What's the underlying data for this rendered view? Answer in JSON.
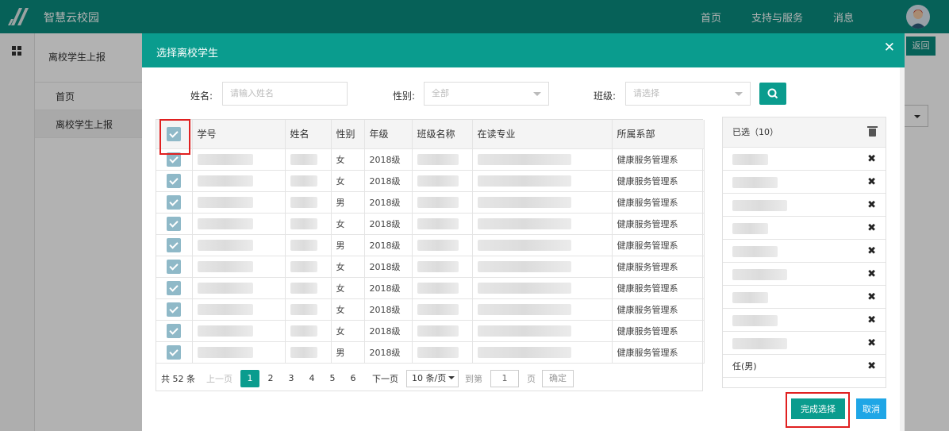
{
  "app": {
    "title": "智慧云校园"
  },
  "top_nav": [
    "首页",
    "支持与服务",
    "消息"
  ],
  "sidebar": {
    "title": "离校学生上报",
    "items": [
      {
        "label": "首页",
        "active": false
      },
      {
        "label": "离校学生上报",
        "active": true
      }
    ]
  },
  "background": {
    "back_button": "返回"
  },
  "modal": {
    "title": "选择离校学生",
    "close_icon": "close-icon",
    "filters": {
      "name_label": "姓名:",
      "name_placeholder": "请输入姓名",
      "gender_label": "性别:",
      "gender_value": "全部",
      "class_label": "班级:",
      "class_placeholder": "请选择",
      "search_icon": "search-icon"
    },
    "table": {
      "columns": [
        "学号",
        "姓名",
        "性别",
        "年级",
        "班级名称",
        "在读专业",
        "所属系部"
      ],
      "rows": [
        {
          "gender": "女",
          "grade": "2018级",
          "dept": "健康服务管理系"
        },
        {
          "gender": "女",
          "grade": "2018级",
          "dept": "健康服务管理系"
        },
        {
          "gender": "男",
          "grade": "2018级",
          "dept": "健康服务管理系"
        },
        {
          "gender": "女",
          "grade": "2018级",
          "dept": "健康服务管理系"
        },
        {
          "gender": "男",
          "grade": "2018级",
          "dept": "健康服务管理系"
        },
        {
          "gender": "女",
          "grade": "2018级",
          "dept": "健康服务管理系"
        },
        {
          "gender": "女",
          "grade": "2018级",
          "dept": "健康服务管理系"
        },
        {
          "gender": "女",
          "grade": "2018级",
          "dept": "健康服务管理系"
        },
        {
          "gender": "女",
          "grade": "2018级",
          "dept": "健康服务管理系"
        },
        {
          "gender": "男",
          "grade": "2018级",
          "dept": "健康服务管理系"
        }
      ]
    },
    "pagination": {
      "total": "共 52 条",
      "prev": "上一页",
      "pages": [
        "1",
        "2",
        "3",
        "4",
        "5",
        "6"
      ],
      "current": "1",
      "next": "下一页",
      "page_size": "10 条/页",
      "goto": "到第",
      "goto_value": "1",
      "page_unit": "页",
      "confirm": "确定"
    },
    "selected": {
      "header": "已选（10）",
      "last_item": "任(男)",
      "item_count": 10
    },
    "buttons": {
      "done": "完成选择",
      "cancel": "取消"
    }
  },
  "colors": {
    "primary": "#0a9c8e",
    "cancel": "#1fa6e6",
    "highlight": "#e02020"
  }
}
